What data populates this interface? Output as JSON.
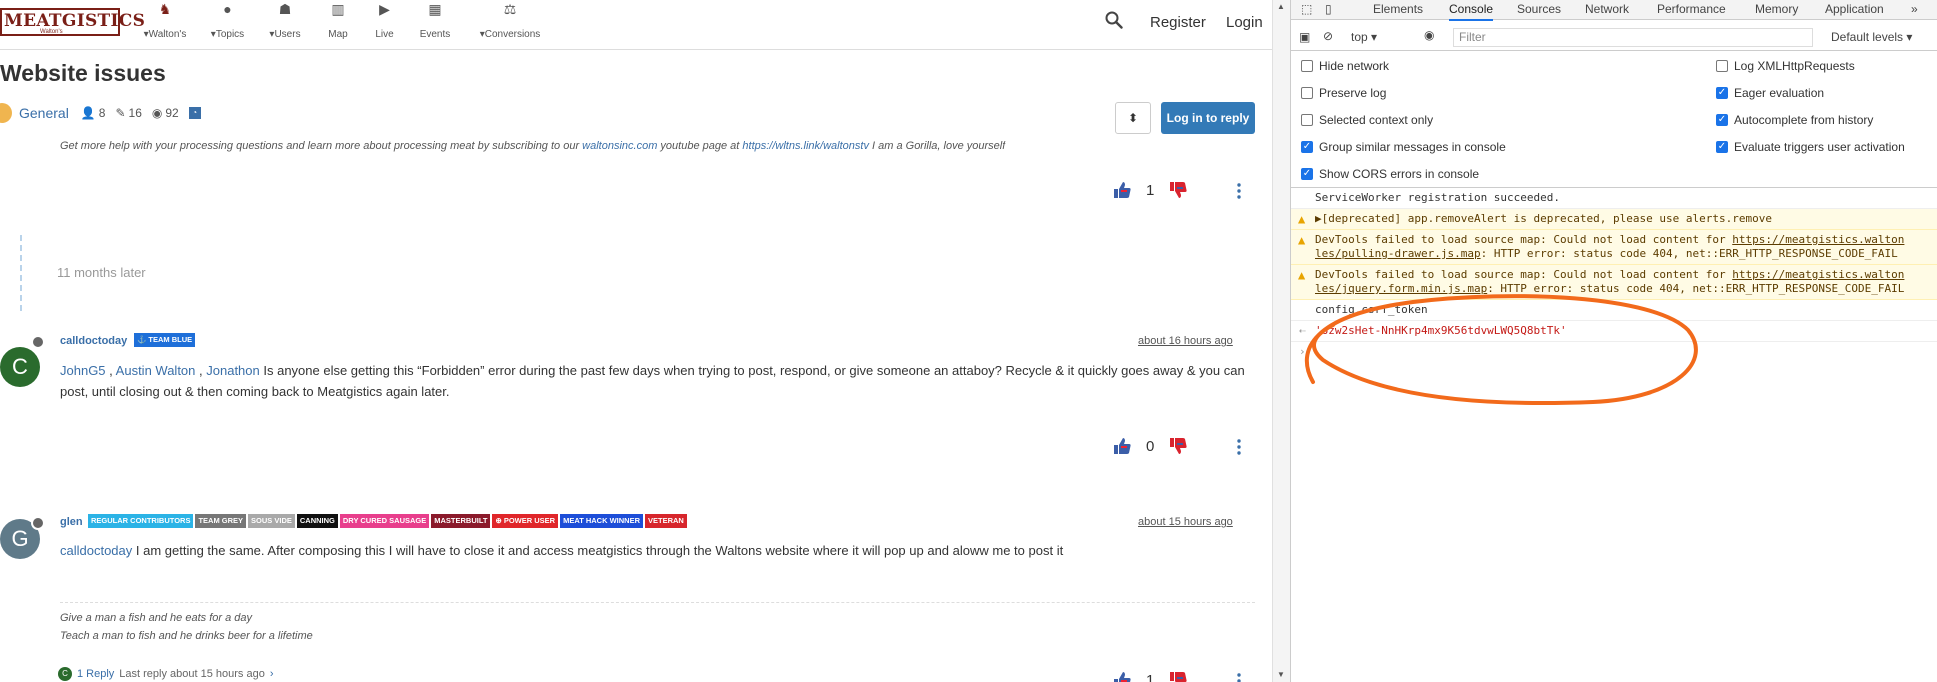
{
  "site": {
    "logo_text": "MEATGISTICS",
    "logo_sub": "Walton's",
    "nav": [
      {
        "label": "Walton's",
        "icon": "walton-logo-icon",
        "caret": true
      },
      {
        "label": "Topics",
        "icon": "topics-icon",
        "caret": true
      },
      {
        "label": "Users",
        "icon": "users-icon",
        "caret": true
      },
      {
        "label": "Map",
        "icon": "map-icon",
        "caret": false
      },
      {
        "label": "Live",
        "icon": "live-icon",
        "caret": false
      },
      {
        "label": "Events",
        "icon": "events-icon",
        "caret": false
      },
      {
        "label": "Conversions",
        "icon": "scale-icon",
        "caret": true
      }
    ],
    "register": "Register",
    "login": "Login"
  },
  "topic": {
    "title": "Website issues",
    "category": "General",
    "posters": "8",
    "posts": "16",
    "views": "92",
    "reply_button": "Log in to reply",
    "sort_icon": "sort-icon"
  },
  "previous_post": {
    "signature_text": "Get more help with your processing questions and learn more about processing meat by subscribing to our ",
    "signature_link1": "waltonsinc.com",
    "signature_text2": " youtube page at ",
    "signature_link2": "https://wltns.link/waltonstv",
    "signature_text3": " I am a Gorilla, love yourself",
    "votes": "1"
  },
  "timeline": {
    "label": "11 months later"
  },
  "posts": [
    {
      "avatar_letter": "C",
      "avatar_color": "#2a6b2d",
      "username": "calldoctoday",
      "badges": [
        {
          "label": "⚓ TEAM BLUE",
          "color": "#1e6fd9"
        }
      ],
      "time": "about 16 hours ago",
      "mentions": [
        "JohnG5",
        "Austin Walton",
        "Jonathon"
      ],
      "body": " Is anyone else getting this “Forbidden” error during the past few days when trying to post, respond, or give someone an attaboy? Recycle & it quickly goes away & you can post, until closing out & then coming back to Meatgistics again later.",
      "votes": "0"
    },
    {
      "avatar_letter": "G",
      "avatar_color": "#5f7a89",
      "username": "glen",
      "badges": [
        {
          "label": "REGULAR CONTRIBUTORS",
          "color": "#2bb3e6"
        },
        {
          "label": "TEAM GREY",
          "color": "#777777"
        },
        {
          "label": "SOUS VIDE",
          "color": "#a9a9a9"
        },
        {
          "label": "CANNING",
          "color": "#111111"
        },
        {
          "label": "DRY CURED SAUSAGE",
          "color": "#e83e8c"
        },
        {
          "label": "MASTERBUILT",
          "color": "#8b1a2b"
        },
        {
          "label": "⊕ POWER USER",
          "color": "#e0262a"
        },
        {
          "label": "MEAT HACK WINNER",
          "color": "#1d4ed8"
        },
        {
          "label": "VETERAN",
          "color": "#d7262c"
        }
      ],
      "time": "about 15 hours ago",
      "mention": "calldoctoday",
      "body": " I am getting the same. After composing this I will have to close it and access meatgistics through the Waltons website where it will pop up and aloww me to post it",
      "signature": [
        "Give a man a fish and he eats for a day",
        "Teach a man to fish and he drinks beer for a lifetime"
      ],
      "replies_label": "1 Reply",
      "last_reply": "Last reply about 15 hours ago",
      "votes": "1"
    }
  ],
  "devtools": {
    "tabs": [
      "Elements",
      "Console",
      "Sources",
      "Network",
      "Performance",
      "Memory",
      "Application"
    ],
    "active_tab": "Console",
    "context": "top",
    "filter_placeholder": "Filter",
    "levels": "Default levels",
    "settings_left": [
      {
        "label": "Hide network",
        "checked": false
      },
      {
        "label": "Preserve log",
        "checked": false
      },
      {
        "label": "Selected context only",
        "checked": false
      },
      {
        "label": "Group similar messages in console",
        "checked": true
      },
      {
        "label": "Show CORS errors in console",
        "checked": true
      }
    ],
    "settings_right": [
      {
        "label": "Log XMLHttpRequests",
        "checked": false
      },
      {
        "label": "Eager evaluation",
        "checked": true
      },
      {
        "label": "Autocomplete from history",
        "checked": true
      },
      {
        "label": "Evaluate triggers user activation",
        "checked": true
      }
    ],
    "console": {
      "line1": "ServiceWorker registration succeeded.",
      "line2": "▶[deprecated] app.removeAlert is deprecated, please use alerts.remove",
      "warn1_a": "DevTools failed to load source map: Could not load content for ",
      "warn1_link": "https://meatgistics.walton",
      "warn1_b_link": "les/pulling-drawer.js.map",
      "warn1_b": ": HTTP error: status code 404, net::ERR_HTTP_RESPONSE_CODE_FAIL",
      "warn2_a": "DevTools failed to load source map: Could not load content for ",
      "warn2_link": "https://meatgistics.walton",
      "warn2_b_link": "les/jquery.form.min.js.map",
      "warn2_b": ": HTTP error: status code 404, net::ERR_HTTP_RESPONSE_CODE_FAIL",
      "input": "config.csrf_token",
      "result": "'ozw2sHet-NnHKrp4mx9K56tdvwLWQ5Q8btTk'"
    },
    "annotation_color": "#f26a1b"
  }
}
